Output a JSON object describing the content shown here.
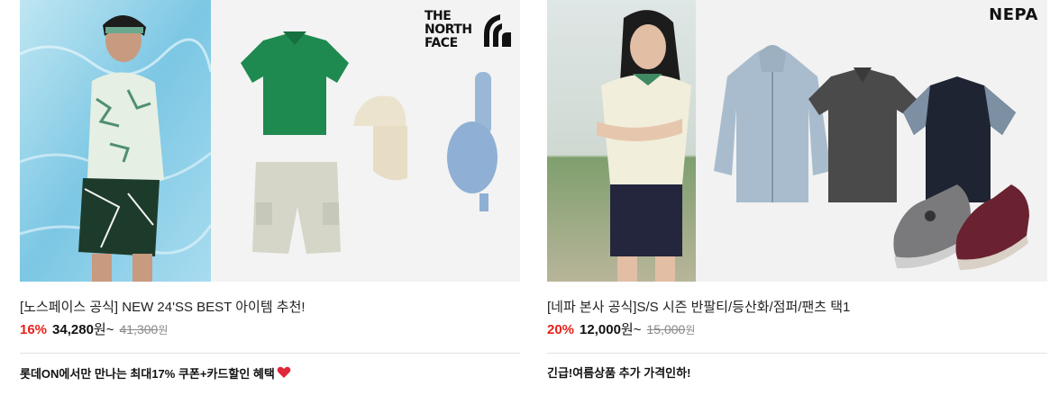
{
  "products": [
    {
      "brand_logo": "THE NORTH FACE",
      "logo_lines": [
        "THE",
        "NORTH",
        "FACE"
      ],
      "title": "[노스페이스 공식] NEW 24'SS BEST 아이템 추천!",
      "discount": "16%",
      "price": "34,280",
      "price_unit": "원~",
      "original_price": "41,300",
      "original_unit": "원",
      "promo": "롯데ON에서만 만나는 최대17% 쿠폰+카드할인 혜택",
      "promo_icon": "heart-icon"
    },
    {
      "brand_logo": "NEPA",
      "title": "[네파 본사 공식]S/S 시즌 반팔티/등산화/점퍼/팬츠 택1",
      "discount": "20%",
      "price": "12,000",
      "price_unit": "원~",
      "original_price": "15,000",
      "original_unit": "원",
      "promo": "긴급!여름상품 추가 가격인하!"
    }
  ],
  "colors": {
    "discount": "#e8211a",
    "text": "#111111",
    "muted": "#888888",
    "divider": "#e2e2e2"
  }
}
